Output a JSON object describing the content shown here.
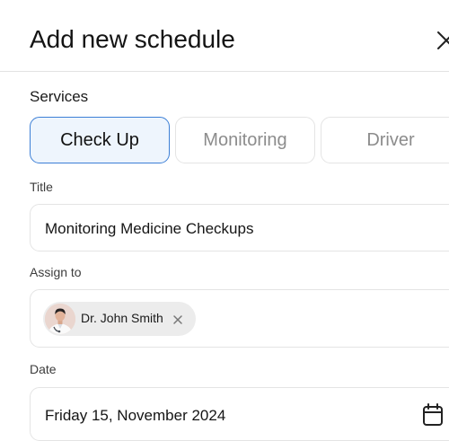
{
  "modal": {
    "title": "Add new schedule"
  },
  "services": {
    "label": "Services",
    "options": [
      {
        "label": "Check Up",
        "selected": true
      },
      {
        "label": "Monitoring",
        "selected": false
      },
      {
        "label": "Driver",
        "selected": false
      }
    ]
  },
  "title_field": {
    "label": "Title",
    "value": "Monitoring Medicine Checkups"
  },
  "assign_field": {
    "label": "Assign to",
    "assignees": [
      {
        "name": "Dr. John Smith"
      }
    ]
  },
  "date_field": {
    "label": "Date",
    "value": "Friday 15, November 2024"
  },
  "icons": {
    "close": "close-icon",
    "remove": "close-icon",
    "calendar": "calendar-icon"
  },
  "colors": {
    "accent": "#3c7fd6",
    "selected_bg": "#eef5fd",
    "border": "#e4e4e4",
    "chip_bg": "#ececec",
    "muted_text": "#8c8c8c"
  }
}
